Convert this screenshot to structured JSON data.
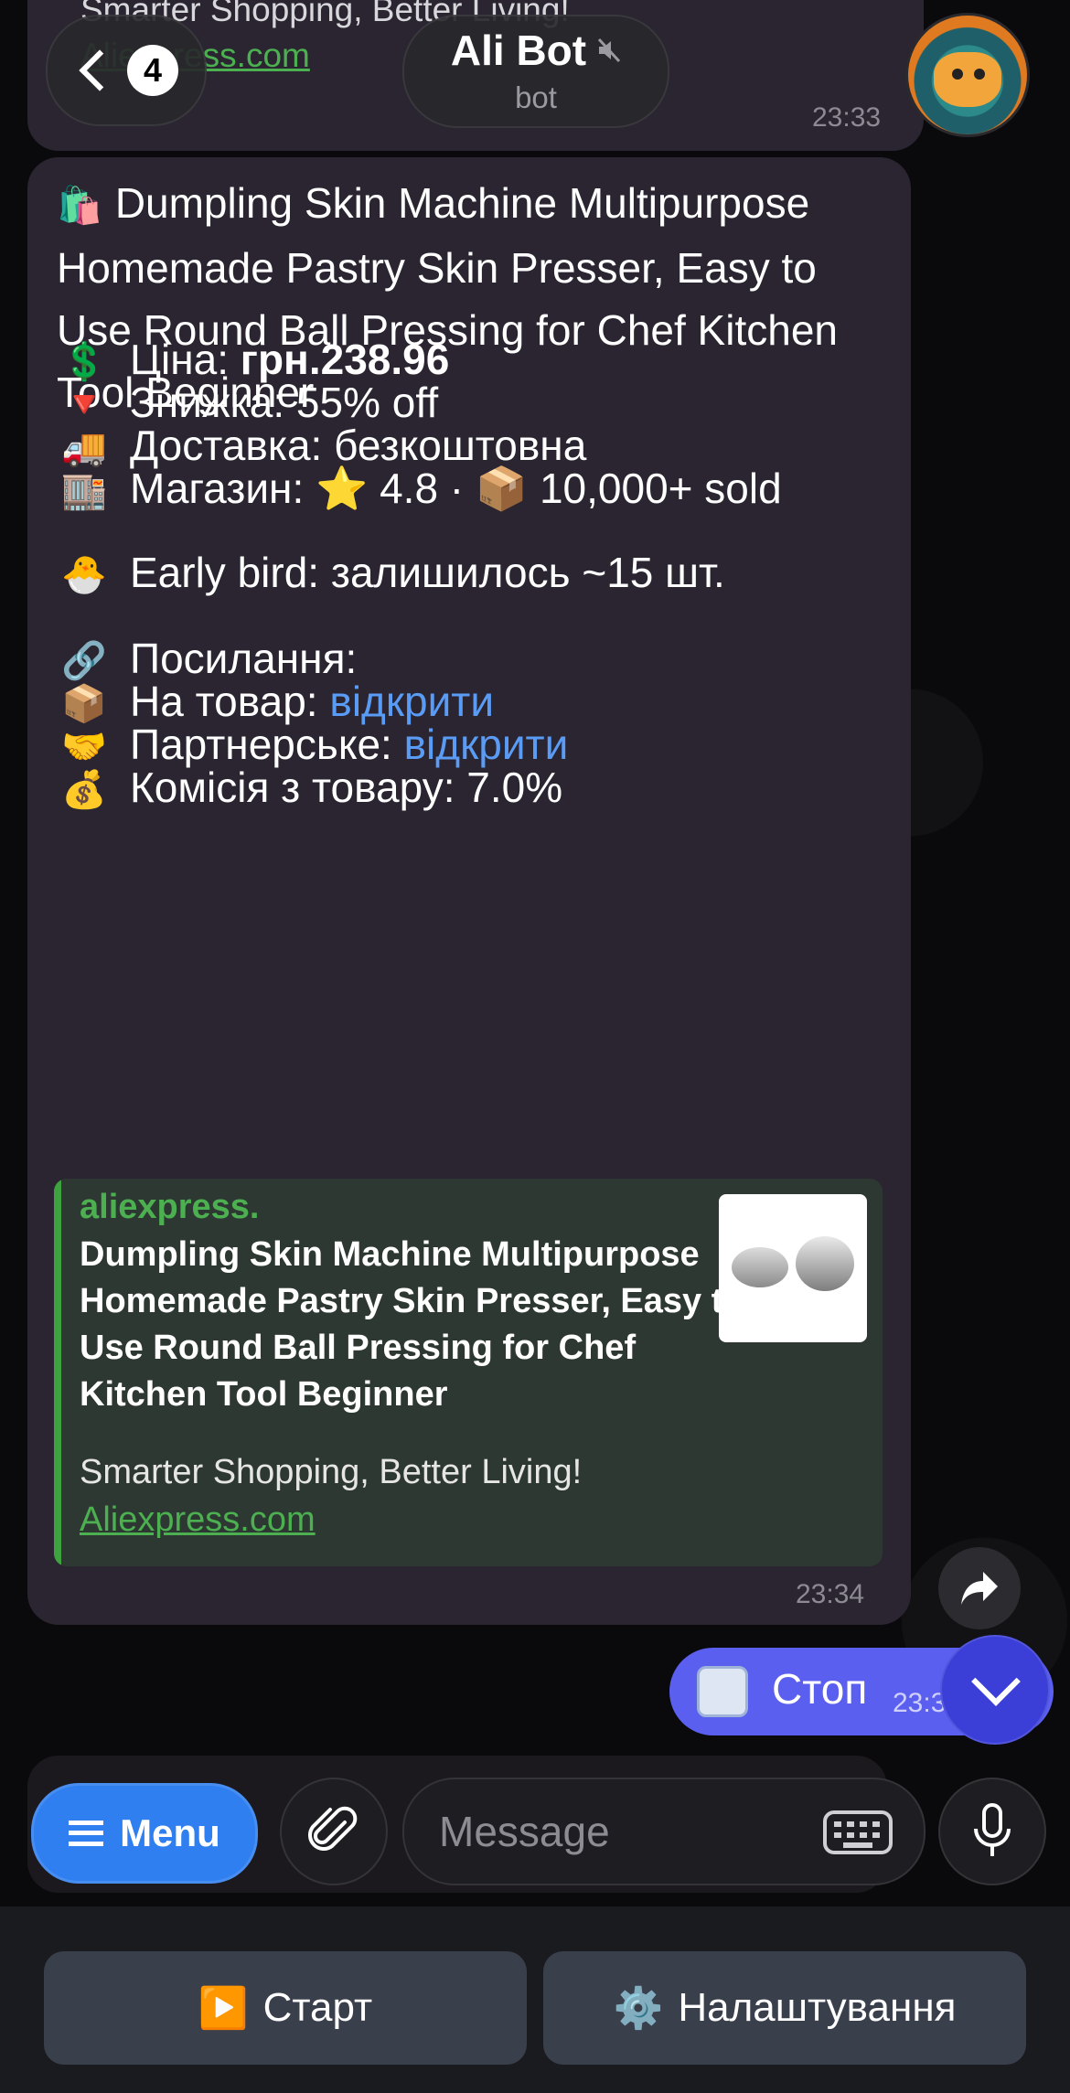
{
  "header": {
    "back_count": "4",
    "chat_title": "Ali Bot",
    "chat_subtitle": "bot"
  },
  "previous_message": {
    "description": "Smarter Shopping, Better Living!",
    "link": "Aliexpress.com",
    "time": "23:33"
  },
  "message": {
    "title_emoji": "🛍️",
    "title": "Dumpling Skin Machine Multipurpose Homemade Pastry Skin Presser, Easy to Use Round Ball Pressing for Chef Kitchen Tool Beginner",
    "price_emoji": "💲",
    "price_label": "Ціна:",
    "price_value": "грн.238.96",
    "discount_emoji": "🔻",
    "discount_text": "Знижка: 55% off",
    "delivery_emoji": "🚚",
    "delivery_text": "Доставка: безкоштовна",
    "store_emoji": "🏬",
    "store_label": "Магазин:",
    "rating_emoji": "⭐",
    "rating_text": "4.8 ·",
    "sold_emoji": "📦",
    "sold_text": "10,000+ sold",
    "early_emoji": "🐣",
    "early_text": "Early bird: залишилось ~15 шт.",
    "links_emoji": "🔗",
    "links_label": "Посилання:",
    "product_emoji": "📦",
    "product_label": "На товар:",
    "product_link": "відкрити",
    "partner_emoji": "🤝",
    "partner_label": "Партнерське:",
    "partner_link": "відкрити",
    "commission_emoji": "💰",
    "commission_text": "Комісія з товару: 7.0%",
    "time": "23:34"
  },
  "preview": {
    "site": "aliexpress.",
    "title": "Dumpling Skin Machine Multipurpose Homemade Pastry Skin Presser, Easy to Use Round Ball Pressing for Chef Kitchen Tool Beginner",
    "description": "Smarter Shopping, Better Living!",
    "link": "Aliexpress.com"
  },
  "outgoing": {
    "text": "Стоп",
    "time": "23:3"
  },
  "input": {
    "menu_label": "Menu",
    "placeholder": "Message"
  },
  "keyboard": {
    "start_emoji": "▶️",
    "start_label": "Старт",
    "settings_emoji": "⚙️",
    "settings_label": "Налаштування"
  },
  "colors": {
    "bubble": "#2a2530",
    "link": "#5a9cf5",
    "preview_accent": "#3ea33e",
    "outgoing": "#5b5ff0",
    "menu": "#2f7ff0"
  }
}
